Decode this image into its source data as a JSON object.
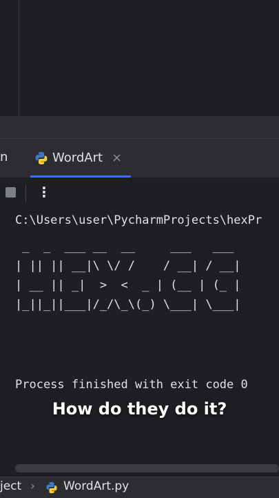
{
  "editor": {},
  "run_panel": {
    "prev_tab_partial": "n",
    "tab": {
      "label": "WordArt",
      "close_glyph": "×",
      "icon": "python-icon"
    },
    "toolbar": {
      "stop_icon": "stop-icon",
      "more_glyph": "⋮"
    }
  },
  "console": {
    "command": "C:\\Users\\user\\PycharmProjects\\hexPr",
    "ascii_art": [
      " _  _  ___ __  __     ___   ___",
      "| || || __|\\ \\/ /    / __| / __|",
      "| __ || _|  >  <  _ | (__ | (_ |",
      "|_||_||___|/_/\\_\\(_) \\___| \\___|"
    ],
    "finish_message": "Process finished with exit code 0"
  },
  "caption": "How do they do it?",
  "statusbar": {
    "breadcrumb_project": "ject",
    "chevron": "›",
    "breadcrumb_file": "WordArt.py"
  },
  "colors": {
    "background": "#1e1f22",
    "panel": "#2b2d30",
    "accent": "#3574f0",
    "text": "#dfe1e5"
  }
}
